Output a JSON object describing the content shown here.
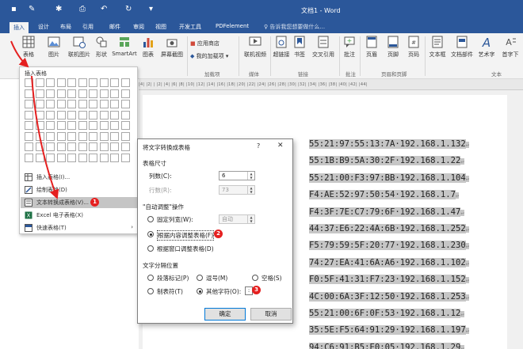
{
  "title_bar": {
    "doc_title": "文档1 - Word"
  },
  "tabs": [
    "插入",
    "设计",
    "布局",
    "引用",
    "邮件",
    "审阅",
    "视图",
    "开发工具",
    "PDFelement"
  ],
  "tell_me": "告诉我您想要做什么...",
  "ribbon": {
    "buttons": [
      "表格",
      "图片",
      "联机图片",
      "形状",
      "SmartArt",
      "图表",
      "屏幕截图",
      "联机视频",
      "超链接",
      "书签",
      "交叉引用",
      "批注",
      "页眉",
      "页脚",
      "页码",
      "文本框",
      "文档部件",
      "艺术字",
      "首字下"
    ],
    "small": [
      "应用商店",
      "我的加载项"
    ],
    "groups": [
      "加载项",
      "媒体",
      "链接",
      "批注",
      "页眉和页脚",
      "文本"
    ]
  },
  "ruler": "|4|  |2|  |   |2|  |4|  |6|  |8|  |10|  |12|  |14|  |16|  |18|  |20|  |22|  |24|  |26|  |28|  |30|  |32|  |34|  |36|  |38|  |40|  |42|  |44|",
  "document_lines": [
    "55:21:97:55:13:7A·192.168.1.132",
    "55:1B:B9:5A:30:2F·192.168.1.22",
    "55:21:00:F3:97:BB·192.168.1.104",
    "F4:AE:52:97:50:54·192.168.1.7",
    "F4:3F:7E:C7:79:6F·192.168.1.47",
    "44:37:E6:22:4A:6B·192.168.1.252",
    "F5:79:59:5F:20:77·192.168.1.230",
    "74:27:EA:41:6A:A6·192.168.1.102",
    "F0:5F:41:31:F7:23·192.168.1.152",
    "4C:00:6A:3F:12:50·192.168.1.253",
    "55:21:00:6F:0F:53·192.168.1.12",
    "35:5E:F5:64:91:29·192.168.1.197",
    "94:C6:91:B5:E0:05·192.168.1.29"
  ],
  "table_menu": {
    "title": "插入表格",
    "items": [
      "插入表格(I)...",
      "绘制表格(D)",
      "文本转换成表格(V)...",
      "Excel 电子表格(X)",
      "快速表格(T)"
    ]
  },
  "dialog": {
    "title": "将文字转换成表格",
    "help": "?",
    "close": "✕",
    "size_section": "表格尺寸",
    "cols_label": "列数(C):",
    "cols_value": "6",
    "rows_label": "行数(R):",
    "rows_value": "73",
    "autofit_section": "\"自动调整\"操作",
    "fixed_label": "固定列宽(W):",
    "fixed_value": "自动",
    "content_label": "根据内容调整表格(F)",
    "window_label": "根据窗口调整表格(D)",
    "sep_section": "文字分隔位置",
    "para_label": "段落标记(P)",
    "comma_label": "逗号(M)",
    "space_label": "空格(S)",
    "tab_label": "制表符(T)",
    "other_label": "其他字符(O):",
    "other_value": ":",
    "ok": "确定",
    "cancel": "取消"
  },
  "badges": [
    "1",
    "2",
    "3"
  ],
  "colors": {
    "title_bar": "#2b579a",
    "badge": "#e52020",
    "highlight": "#c6c6c6"
  }
}
